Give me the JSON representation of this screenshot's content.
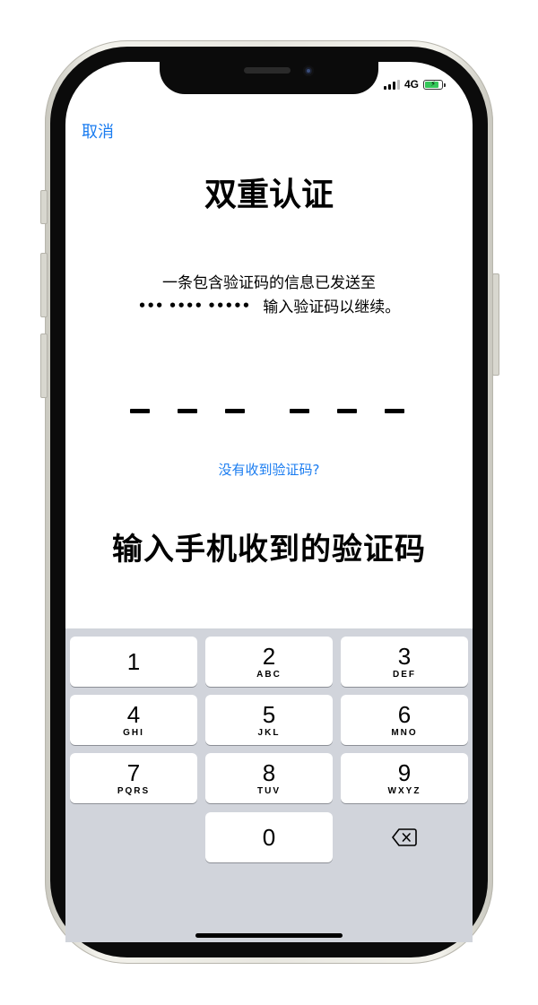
{
  "status_bar": {
    "network": "4G",
    "battery_color": "#35c759"
  },
  "header": {
    "cancel_label": "取消"
  },
  "main": {
    "title": "双重认证",
    "message_line1": "一条包含验证码的信息已发送至",
    "masked_number": "••• •••• •••••",
    "message_line2": "输入验证码以继续。",
    "code_digits": 6,
    "resend_link": "没有收到验证码?",
    "caption": "输入手机收到的验证码"
  },
  "keypad": {
    "keys": [
      {
        "digit": "1",
        "letters": ""
      },
      {
        "digit": "2",
        "letters": "ABC"
      },
      {
        "digit": "3",
        "letters": "DEF"
      },
      {
        "digit": "4",
        "letters": "GHI"
      },
      {
        "digit": "5",
        "letters": "JKL"
      },
      {
        "digit": "6",
        "letters": "MNO"
      },
      {
        "digit": "7",
        "letters": "PQRS"
      },
      {
        "digit": "8",
        "letters": "TUV"
      },
      {
        "digit": "9",
        "letters": "WXYZ"
      },
      {
        "digit": "0",
        "letters": ""
      }
    ],
    "delete_icon": "backspace-icon"
  },
  "colors": {
    "accent": "#1a7cf0",
    "keypad_bg": "#d1d4db",
    "key_bg": "#ffffff"
  }
}
